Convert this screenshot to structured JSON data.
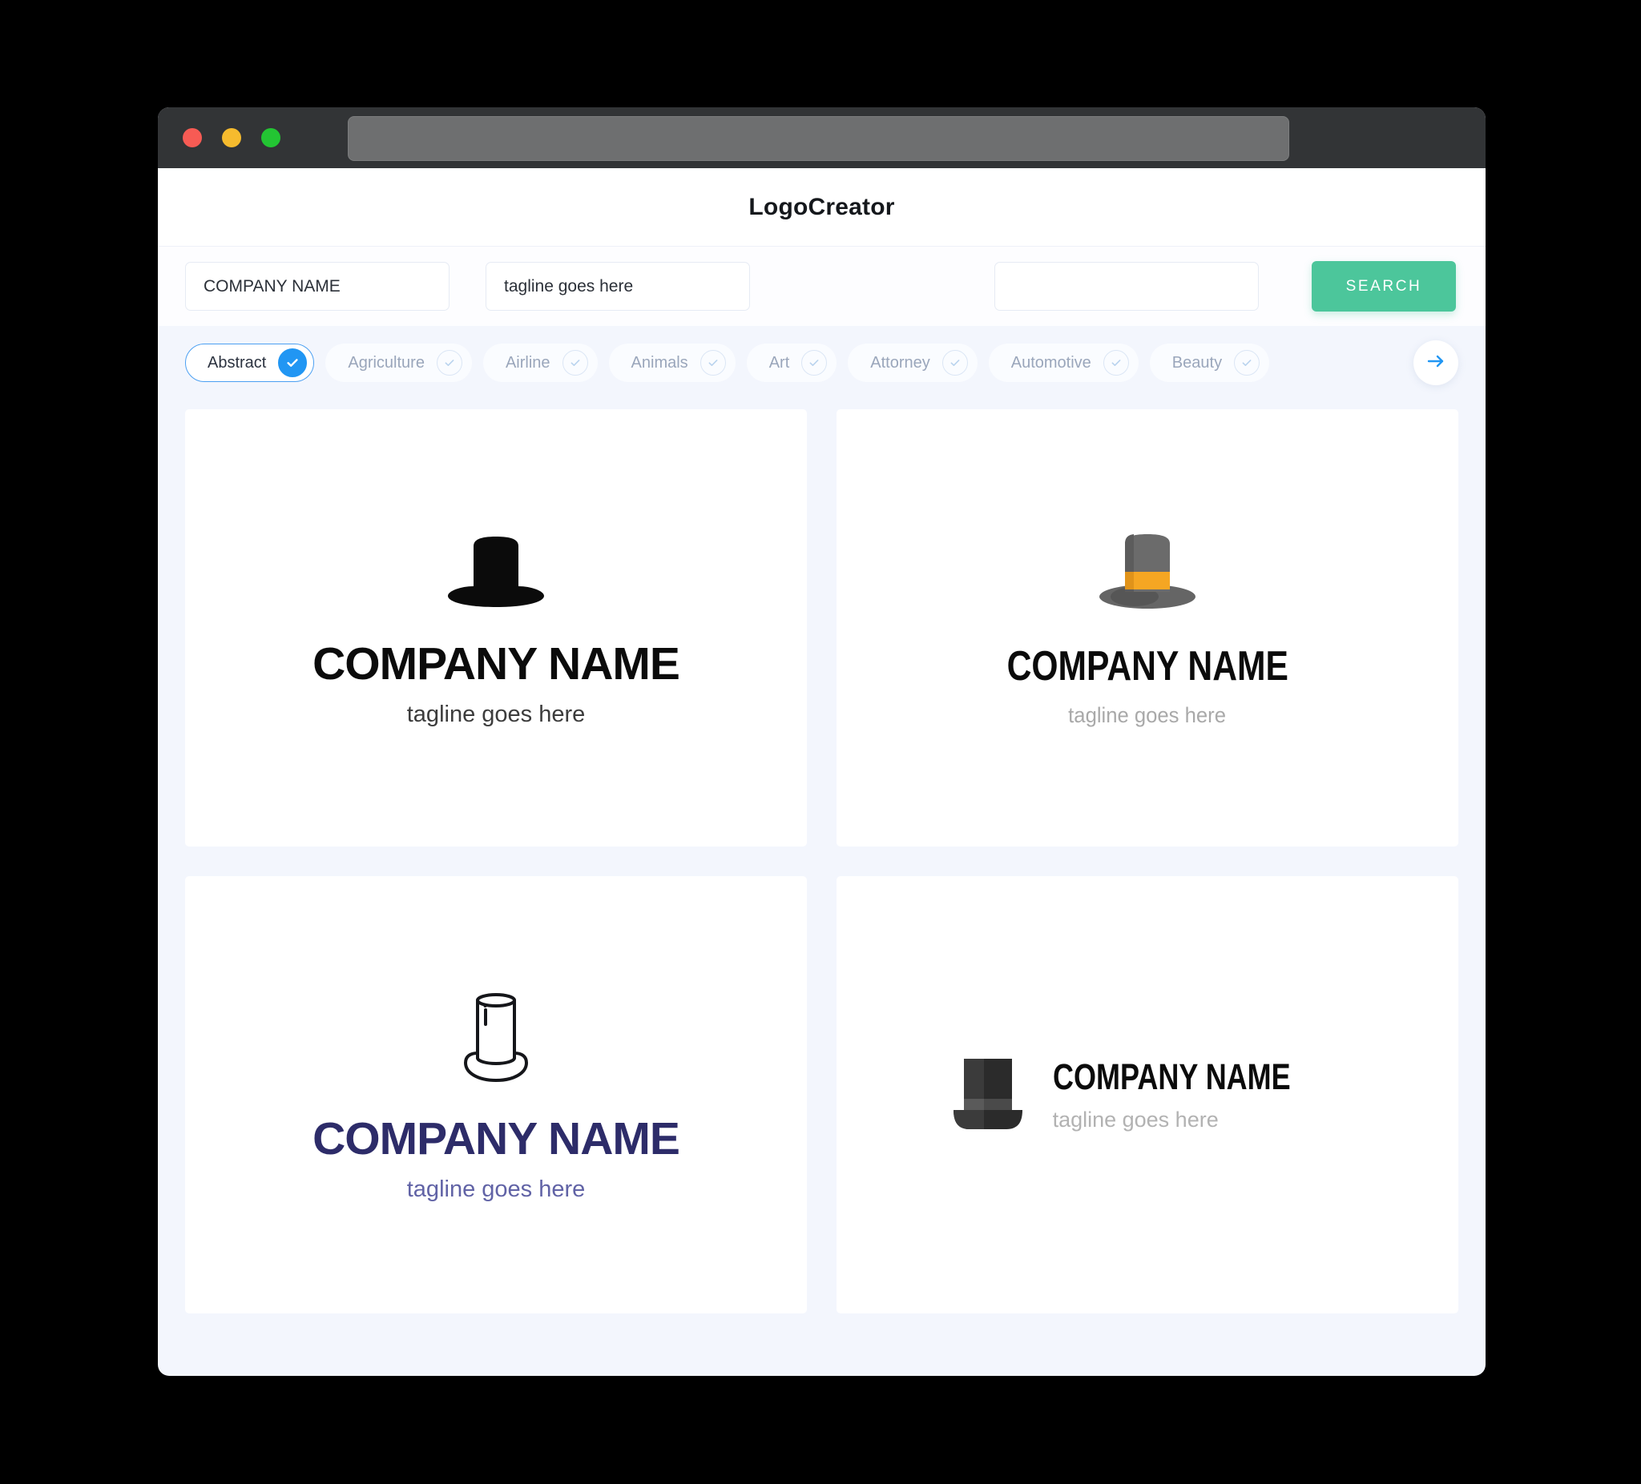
{
  "browser": {
    "traffic_lights": [
      "close-red",
      "minimize-yellow",
      "maximize-green"
    ],
    "url_value": "",
    "colors": {
      "close": "#f75b54",
      "minimize": "#f6bb2e",
      "maximize": "#23c533"
    }
  },
  "header": {
    "title": "LogoCreator"
  },
  "search": {
    "company_value": "COMPANY NAME",
    "company_placeholder": "COMPANY NAME",
    "tagline_value": "tagline goes here",
    "tagline_placeholder": "tagline goes here",
    "extra_value": "",
    "extra_placeholder": "",
    "button_label": "SEARCH",
    "button_color": "#4cc69b"
  },
  "categories": {
    "next_icon": "arrow-right-icon",
    "accent_selected": "#2196f3",
    "items": [
      {
        "label": "Abstract",
        "selected": true
      },
      {
        "label": "Agriculture",
        "selected": false
      },
      {
        "label": "Airline",
        "selected": false
      },
      {
        "label": "Animals",
        "selected": false
      },
      {
        "label": "Art",
        "selected": false
      },
      {
        "label": "Attorney",
        "selected": false
      },
      {
        "label": "Automotive",
        "selected": false
      },
      {
        "label": "Beauty",
        "selected": false
      }
    ]
  },
  "results": {
    "cards": [
      {
        "id": "logo-card-1",
        "icon": "top-hat-solid-black-icon",
        "name": "COMPANY NAME",
        "tagline": "tagline goes here",
        "name_color": "#0b0b0b",
        "tagline_color": "#3c3c3c",
        "layout": "stacked"
      },
      {
        "id": "logo-card-2",
        "icon": "top-hat-gray-orange-band-icon",
        "name": "COMPANY NAME",
        "tagline": "tagline goes here",
        "name_color": "#0b0b0b",
        "tagline_color": "#a9a9a9",
        "layout": "stacked"
      },
      {
        "id": "logo-card-3",
        "icon": "top-hat-outline-icon",
        "name": "COMPANY NAME",
        "tagline": "tagline goes here",
        "name_color": "#2d2c69",
        "tagline_color": "#6163a6",
        "layout": "stacked"
      },
      {
        "id": "logo-card-4",
        "icon": "top-hat-dark-flat-icon",
        "name": "COMPANY NAME",
        "tagline": "tagline goes here",
        "name_color": "#0b0b0b",
        "tagline_color": "#b2b2b2",
        "layout": "horizontal"
      }
    ]
  }
}
